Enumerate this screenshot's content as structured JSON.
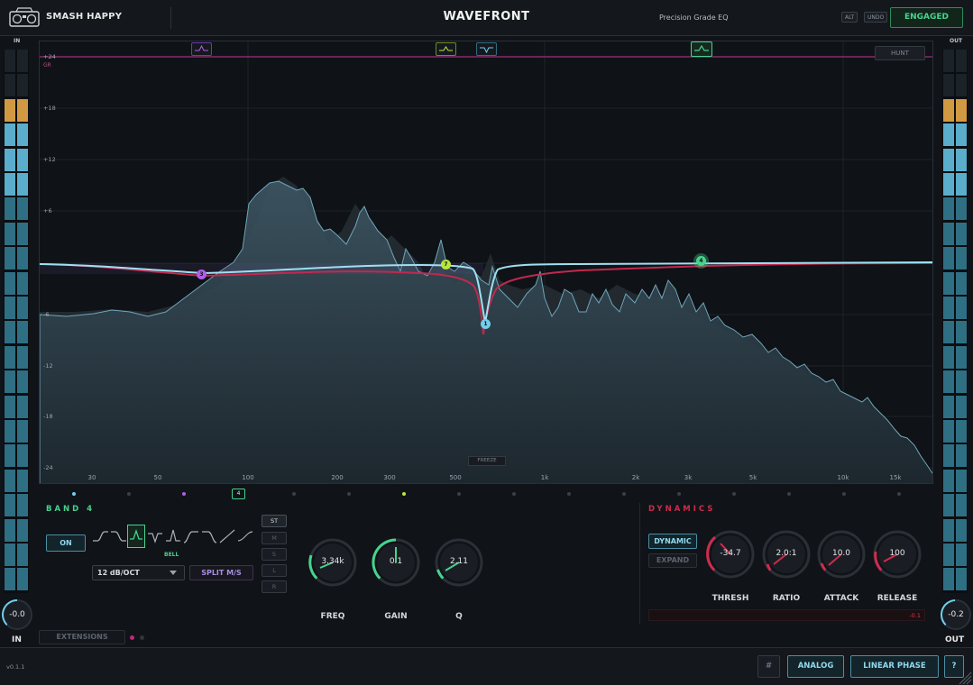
{
  "header": {
    "brand": "SMASH HAPPY",
    "product": "WAVEFRONT",
    "subtitle": "Precision Grade EQ",
    "alt_label": "ALT",
    "undo_label": "UNDO",
    "engaged_label": "ENGAGED"
  },
  "meters": {
    "in_label": "IN",
    "out_label": "OUT",
    "in_level": "-0.0",
    "out_level": "-0.2",
    "in_knob_label": "IN",
    "out_knob_label": "OUT"
  },
  "graph": {
    "db_labels": [
      "+24",
      "+18",
      "+12",
      "+6",
      "-6",
      "-12",
      "-18",
      "-24"
    ],
    "gr_label": "GR",
    "freq_labels": [
      "30",
      "50",
      "100",
      "200",
      "300",
      "500",
      "1k",
      "2k",
      "3k",
      "5k",
      "10k",
      "15k"
    ],
    "hunt_label": "HUNT",
    "freeze_label": "FREEZE",
    "nodes": [
      "3",
      "7",
      "1",
      "4"
    ]
  },
  "band": {
    "title": "BAND 4",
    "indicator": "4",
    "on_label": "ON",
    "shape_label": "BELL",
    "slope": "12 dB/OCT",
    "split_label": "SPLIT M/S",
    "channel_modes": [
      "ST",
      "M",
      "S",
      "L",
      "R"
    ],
    "knobs": {
      "freq": {
        "label": "FREQ",
        "value": "3.34k"
      },
      "gain": {
        "label": "GAIN",
        "value": "0.1"
      },
      "q": {
        "label": "Q",
        "value": "2.11"
      }
    }
  },
  "dynamics": {
    "title": "DYNAMICS",
    "dynamic_label": "DYNAMIC",
    "expand_label": "EXPAND",
    "knobs": {
      "thresh": {
        "label": "THRESH",
        "value": "-34.7"
      },
      "ratio": {
        "label": "RATIO",
        "value": "2.0:1"
      },
      "attack": {
        "label": "ATTACK",
        "value": "10.0"
      },
      "release": {
        "label": "RELEASE",
        "value": "100"
      }
    },
    "gr_value": "-0.1"
  },
  "footer": {
    "extensions_label": "EXTENSIONS",
    "version": "v0.1.1",
    "hash_label": "#",
    "analog_label": "ANALOG",
    "linear_phase_label": "LINEAR PHASE",
    "help_label": "?"
  },
  "colors": {
    "accent_green": "#46d48d",
    "accent_cyan": "#6fd0ec",
    "dynamics_red": "#d02b4d",
    "band3_purple": "#b05ee8",
    "band7_lime": "#b7e83b"
  }
}
